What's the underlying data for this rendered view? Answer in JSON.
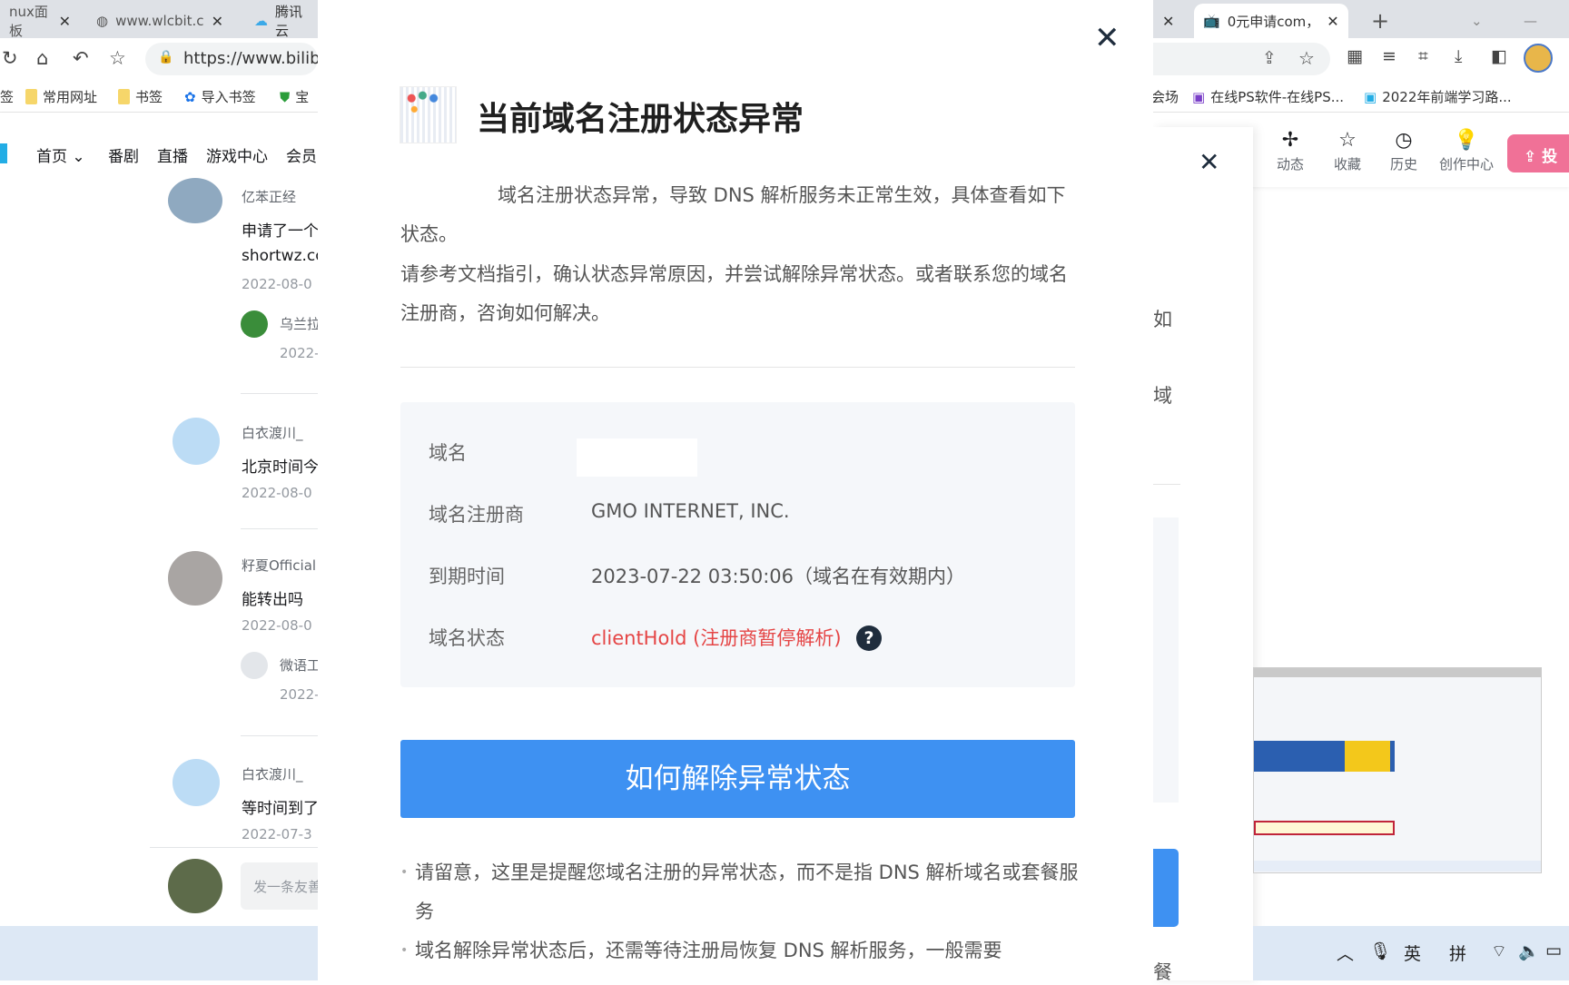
{
  "browser": {
    "tabs": [
      {
        "label": "nux面板",
        "icon": "panel-icon"
      },
      {
        "label": "www.wlcbit.c",
        "icon": "globe-icon"
      },
      {
        "label": "腾讯云",
        "icon": "cloud-icon"
      },
      {
        "label": "0元申请com，",
        "icon": "bilibili-icon",
        "active": true
      }
    ],
    "new_tab": "+",
    "url": "https://www.bilibi",
    "bookmarks_left": [
      "签",
      "常用网址",
      "书签",
      "导入书签",
      "宝"
    ],
    "bookmarks_right": [
      "会场",
      "在线PS软件-在线PS...",
      "2022年前端学习路..."
    ]
  },
  "site_nav": {
    "items": [
      "首页",
      "番剧",
      "直播",
      "游戏中心",
      "会员"
    ],
    "right_items": [
      "动态",
      "收藏",
      "历史",
      "创作中心"
    ],
    "upload_label": "投"
  },
  "comments": [
    {
      "name": "亿苯正经",
      "text": "申请了一个",
      "text2": "shortwz.co",
      "date": "2022-08-0",
      "reply_name": "乌兰拉",
      "reply_date": "2022-"
    },
    {
      "name": "白衣渡川_",
      "text": "北京时间今",
      "date": "2022-08-0"
    },
    {
      "name": "籽夏Official",
      "text": "能转出吗",
      "date": "2022-08-0",
      "reply_name": "微语工",
      "reply_date": "2022-"
    },
    {
      "name": "白衣渡川_",
      "text": "等时间到了",
      "date": "2022-07-3"
    }
  ],
  "comment_input_placeholder": "发一条友善",
  "modal": {
    "title": "当前域名注册状态异常",
    "para1": "域名注册状态异常，导致 DNS 解析服务未正常生效，具体查看如下状态。",
    "para2": "请参考文档指引，确认状态异常原因，并尝试解除异常状态。或者联系您的域名注册商，咨询如何解决。",
    "rows": [
      {
        "label": "域名",
        "value": ""
      },
      {
        "label": "域名注册商",
        "value": "GMO INTERNET, INC."
      },
      {
        "label": "到期时间",
        "value": "2023-07-22 03:50:06（域名在有效期内）"
      },
      {
        "label": "域名状态",
        "value": "clientHold (注册商暂停解析)"
      }
    ],
    "status_color": "#e54545",
    "button_label": "如何解除异常状态",
    "button_color": "#3e91f2",
    "notes": [
      "请留意，这里是提醒您域名注册的异常状态，而不是指 DNS 解析域名或套餐服务",
      "域名解除异常状态后，还需等待注册局恢复 DNS 解析服务，一般需要"
    ]
  },
  "behind_modal": {
    "fragments": [
      "如",
      "域",
      "餐"
    ]
  },
  "tray": {
    "ime1": "英",
    "ime2": "拼"
  }
}
